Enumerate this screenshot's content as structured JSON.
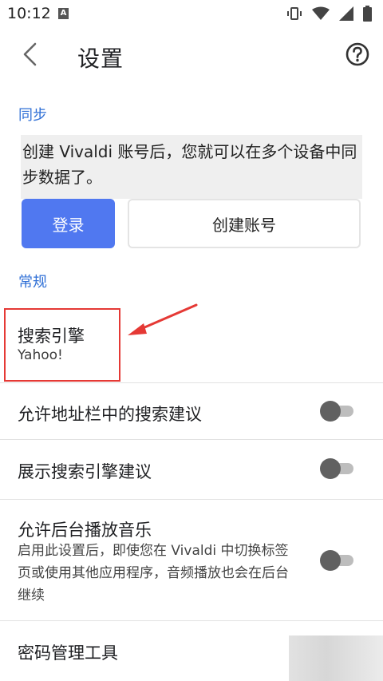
{
  "status_bar": {
    "time": "10:12",
    "notification_letter": "A",
    "icons": [
      "vibrate-icon",
      "wifi-icon",
      "signal-icon",
      "battery-icon"
    ]
  },
  "app_bar": {
    "title": "设置",
    "back_icon": "chevron-left-icon",
    "help_icon": "help-circle-icon"
  },
  "sync": {
    "header": "同步",
    "description": "创建 Vivaldi 账号后，您就可以在多个设备中同步数据了。",
    "login_label": "登录",
    "create_label": "创建账号",
    "login_color": "#5078f0"
  },
  "general": {
    "header": "常规",
    "search_engine": {
      "title": "搜索引擎",
      "value": "Yahoo!"
    },
    "address_bar_suggestions": {
      "title": "允许地址栏中的搜索建议",
      "enabled": false
    },
    "show_engine_suggestions": {
      "title": "展示搜索引擎建议",
      "enabled": false
    },
    "background_music": {
      "title": "允许后台播放音乐",
      "description": "启用此设置后，即使您在 Vivaldi 中切换标签页或使用其他应用程序，音频播放也会在后台继续",
      "enabled": false
    },
    "password_manager": {
      "title": "密码管理工具"
    }
  },
  "colors": {
    "accent": "#2f6fd6",
    "annotation": "#e53935"
  }
}
